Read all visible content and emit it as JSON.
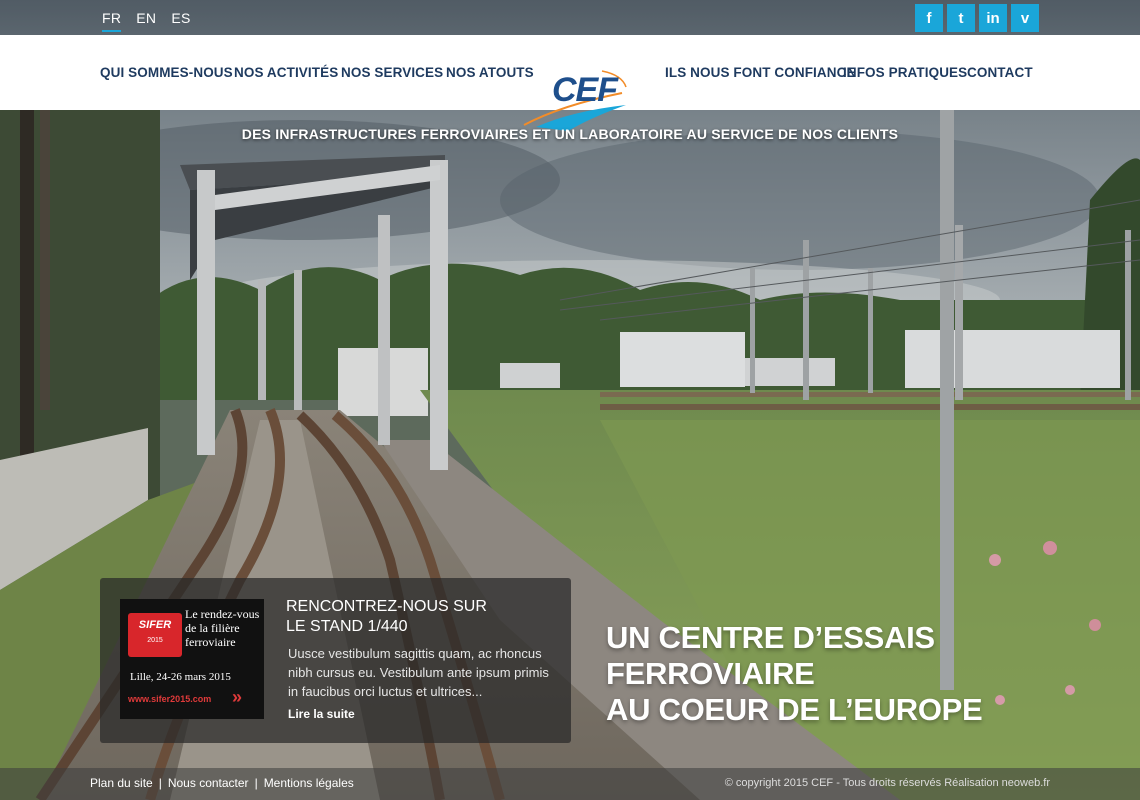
{
  "languages": [
    {
      "label": "FR",
      "active": true
    },
    {
      "label": "EN",
      "active": false
    },
    {
      "label": "ES",
      "active": false
    }
  ],
  "social": [
    {
      "icon": "facebook-icon",
      "glyph": "f"
    },
    {
      "icon": "twitter-icon",
      "glyph": "t"
    },
    {
      "icon": "linkedin-icon",
      "glyph": "in"
    },
    {
      "icon": "viadeo-icon",
      "glyph": "v"
    }
  ],
  "nav": {
    "left": [
      "QUI SOMMES-NOUS",
      "NOS ACTIVITÉS",
      "NOS SERVICES",
      "NOS ATOUTS"
    ],
    "right": [
      "ILS NOUS FONT CONFIANCE",
      "INFOS PRATIQUES",
      "CONTACT"
    ],
    "logo_text": "CEF"
  },
  "tagline": "DES INFRASTRUCTURES FERROVIAIRES ET UN LABORATOIRE AU SERVICE DE NOS CLIENTS",
  "news": {
    "promo": {
      "badge": "SIFER",
      "badge_year": "2015",
      "title": "Le rendez-vous de la filière ferroviaire",
      "date": "Lille, 24-26 mars 2015",
      "url": "www.sifer2015.com",
      "arrow": "»"
    },
    "title_line1": "RENCONTREZ-NOUS SUR",
    "title_line2": "LE STAND 1/440",
    "body": "Uusce vestibulum sagittis quam, ac rhoncus nibh cursus eu. Vestibulum ante ipsum primis in faucibus orci luctus et ultrices...",
    "more": "Lire la suite"
  },
  "headline": {
    "line1": "UN CENTRE D’ESSAIS FERROVIAIRE",
    "line2": "AU COEUR DE L’EUROPE"
  },
  "footer": {
    "links": [
      "Plan du site",
      "Nous contacter",
      "Mentions légales"
    ],
    "separator": "|",
    "copyright": "© copyright 2015 CEF - Tous droits réservés Réalisation neoweb.fr"
  },
  "colors": {
    "accent": "#1aa6d9",
    "nav_text": "#1e3a5f",
    "logo_blue": "#1e4f8c",
    "logo_orange": "#f28c28"
  }
}
